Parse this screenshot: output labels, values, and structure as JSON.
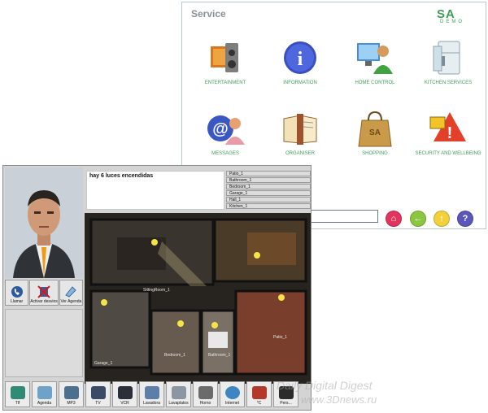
{
  "service": {
    "title": "Service",
    "logo": {
      "big": "SA",
      "small": "DEMO"
    },
    "tiles": [
      {
        "label": "ENTERTAINMENT",
        "icon": "tv-icon"
      },
      {
        "label": "INFORMATION",
        "icon": "info-icon"
      },
      {
        "label": "HOME CONTROL",
        "icon": "home-control-icon"
      },
      {
        "label": "KITCHEN SERVICES",
        "icon": "fridge-icon"
      },
      {
        "label": "MESSAGES",
        "icon": "email-icon"
      },
      {
        "label": "ORGANISER",
        "icon": "organiser-icon"
      },
      {
        "label": "SHOPPING",
        "icon": "shopping-bag-icon"
      },
      {
        "label": "SECURITY AND WELLBEING",
        "icon": "security-icon"
      }
    ],
    "nav": [
      {
        "name": "home",
        "color": "#e2345c",
        "glyph": "⌂"
      },
      {
        "name": "back",
        "color": "#8cc63f",
        "glyph": "←"
      },
      {
        "name": "up",
        "color": "#f2d13a",
        "glyph": "↑"
      },
      {
        "name": "help",
        "color": "#5a57b8",
        "glyph": "?"
      }
    ]
  },
  "home": {
    "message": "hay 6 luces encendidas",
    "rooms": [
      "Patio_1",
      "Bathroom_1",
      "Bedroom_1",
      "Garage_1",
      "Hall_1",
      "Kitchen_1"
    ],
    "contact_buttons": [
      {
        "label": "Llamar",
        "icon": "phone-icon"
      },
      {
        "label": "Activar desvios",
        "icon": "call-forward-icon"
      },
      {
        "label": "Ver Agenda",
        "icon": "agenda-icon"
      }
    ],
    "plan_labels": {
      "sitting": "SittingRoom_1",
      "garage": "Garage_1",
      "bedroom": "Bedroom_1",
      "bathroom": "Bathroom_1",
      "patio": "Patio_1"
    },
    "toolbar": [
      {
        "label": "Tlf",
        "color": "#2f8a76"
      },
      {
        "label": "Agenda",
        "color": "#6fa2c8"
      },
      {
        "label": "MP3",
        "color": "#4b6f8d"
      },
      {
        "label": "TV",
        "color": "#3b4a66"
      },
      {
        "label": "VCR",
        "color": "#2a2f3a"
      },
      {
        "label": "Lavadora",
        "color": "#5d7ea6"
      },
      {
        "label": "Lavaplatos",
        "color": "#8c96a2"
      },
      {
        "label": "Horno",
        "color": "#6b6b6b"
      },
      {
        "label": "Internet",
        "color": "#3d86c2"
      },
      {
        "label": "°C",
        "color": "#b33a2a"
      },
      {
        "label": "Pers...",
        "color": "#2b2b2b"
      }
    ]
  },
  "watermark": {
    "line1": "Daily Digital Digest",
    "line2": "www.3Dnews.ru"
  }
}
